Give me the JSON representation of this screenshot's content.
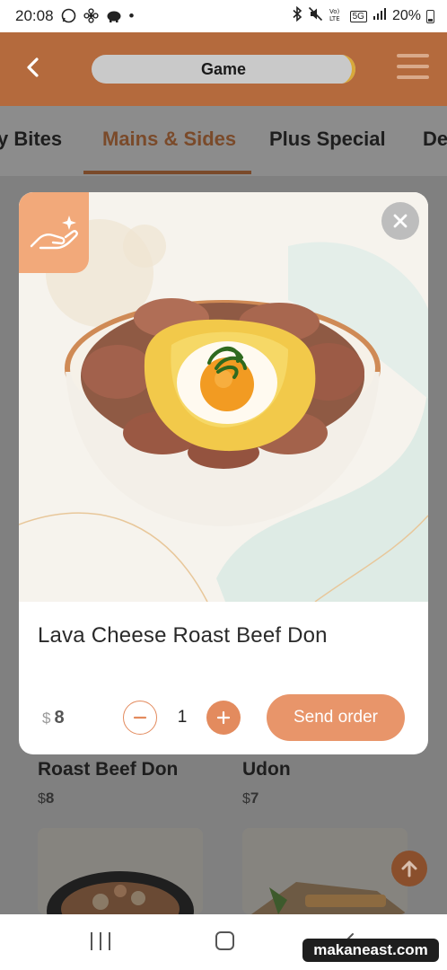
{
  "status_bar": {
    "time": "20:08",
    "dot": "•",
    "network": "5G",
    "battery": "20%"
  },
  "header": {
    "title": "Game",
    "back_icon": "chevron-left-icon",
    "menu_icon": "hamburger-menu-icon"
  },
  "tabs": [
    {
      "label": "y Bites"
    },
    {
      "label": "Mains & Sides"
    },
    {
      "label": "Plus Special"
    },
    {
      "label": "De"
    }
  ],
  "menu_items": [
    {
      "name": "Roast Beef Don",
      "currency": "$",
      "price": "8"
    },
    {
      "name": "Udon",
      "currency": "$",
      "price": "7"
    }
  ],
  "modal": {
    "item_name": "Lava Cheese Roast Beef Don",
    "currency": "$",
    "price": "8",
    "quantity": "1",
    "send_label": "Send order",
    "badge_icon": "hand-sparkle-icon",
    "close_icon": "close-icon"
  },
  "watermark": "makaneast.com",
  "colors": {
    "header_brown": "#b46a3d",
    "accent_orange": "#e8956a",
    "active_tab": "#7a4a2a"
  }
}
